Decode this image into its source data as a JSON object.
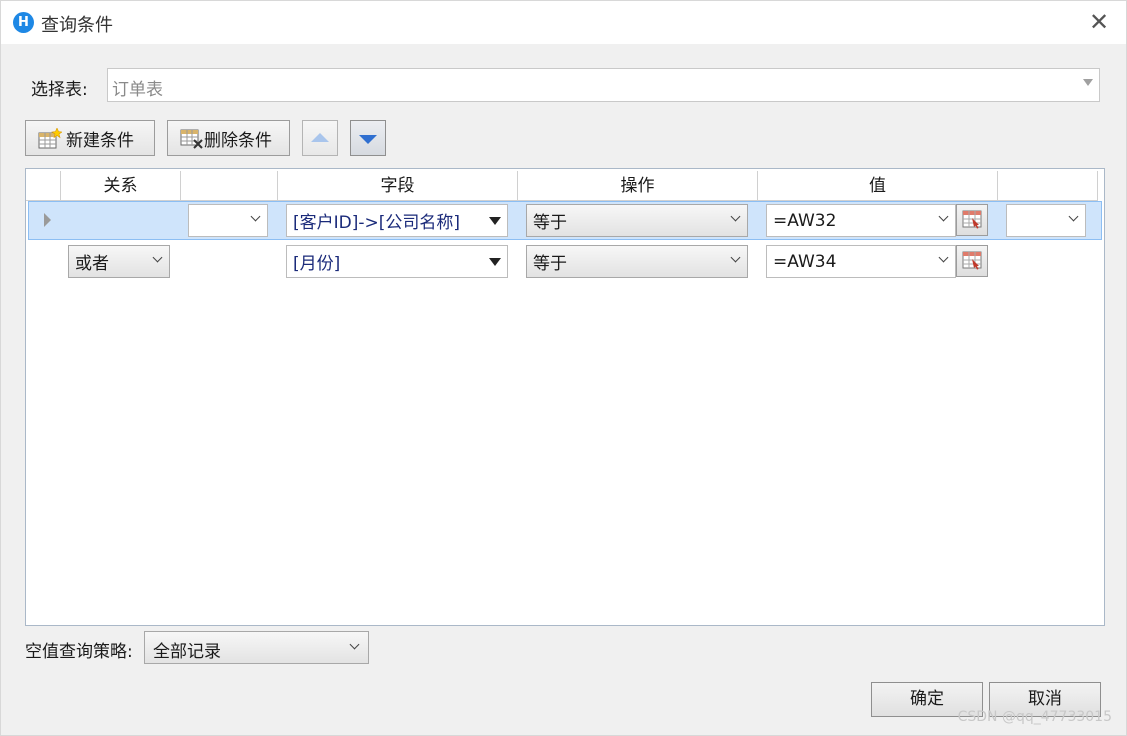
{
  "window": {
    "title": "查询条件",
    "close_symbol": "✕",
    "icon_glyph": "H"
  },
  "table_row": {
    "label": "选择表:",
    "value": "订单表"
  },
  "toolbar": {
    "new_label": "新建条件",
    "delete_label": "删除条件"
  },
  "grid": {
    "headers": {
      "relation": "关系",
      "field": "字段",
      "operation": "操作",
      "value": "值"
    },
    "rows": [
      {
        "relation": "",
        "left_paren": "",
        "field": "[客户ID]->[公司名称]",
        "operation": "等于",
        "value": "=AW32",
        "right_paren": "",
        "selected": true
      },
      {
        "relation": "或者",
        "left_paren": "",
        "field": "[月份]",
        "operation": "等于",
        "value": "=AW34",
        "right_paren": "",
        "selected": false
      }
    ]
  },
  "null_strategy": {
    "label": "空值查询策略:",
    "value": "全部记录"
  },
  "footer": {
    "ok_label": "确定",
    "cancel_label": "取消"
  },
  "watermark": "CSDN @qq_47733015",
  "colors": {
    "accent": "#1e88e5",
    "selection": "#cfe4fb",
    "arrow_blue": "#2f6fd0"
  }
}
